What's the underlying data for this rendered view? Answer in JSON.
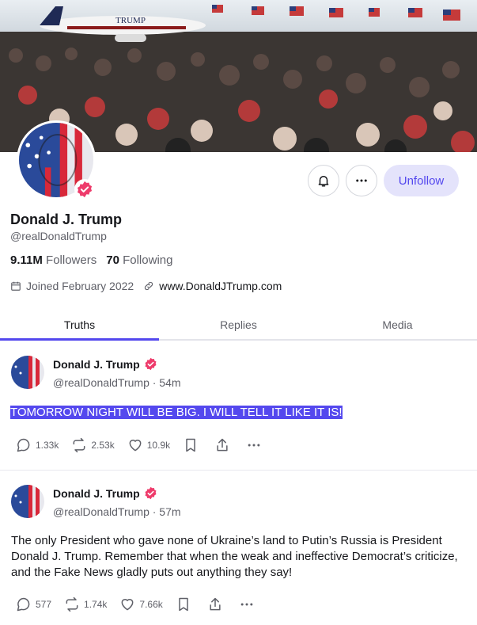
{
  "banner": {
    "plane_text": "TRUMP"
  },
  "profile": {
    "name": "Donald J. Trump",
    "handle": "@realDonaldTrump",
    "followers_count": "9.11M",
    "followers_label": "Followers",
    "following_count": "70",
    "following_label": "Following",
    "joined": "Joined February 2022",
    "website": "www.DonaldJTrump.com"
  },
  "actions": {
    "unfollow_label": "Unfollow"
  },
  "tabs": [
    {
      "label": "Truths",
      "active": true
    },
    {
      "label": "Replies",
      "active": false
    },
    {
      "label": "Media",
      "active": false
    }
  ],
  "posts": [
    {
      "author": "Donald J. Trump",
      "meta": "@realDonaldTrump · 54m",
      "text": "TOMORROW NIGHT WILL BE BIG. I WILL TELL IT LIKE IT IS!",
      "replies": "1.33k",
      "retruths": "2.53k",
      "likes": "10.9k"
    },
    {
      "author": "Donald J. Trump",
      "meta": "@realDonaldTrump · 57m",
      "text": "The only President who gave none of Ukraine’s land to Putin’s Russia is President Donald J. Trump. Remember that when the weak and ineffective Democrat’s criticize, and the Fake News gladly puts out anything they say!",
      "replies": "577",
      "retruths": "1.74k",
      "likes": "7.66k"
    }
  ],
  "colors": {
    "accent": "#5448ee",
    "verified": "#ee3b6b",
    "unfollow_bg": "#e4e3fb"
  },
  "icons": [
    "bell-icon",
    "more-icon",
    "calendar-icon",
    "link-icon",
    "reply-icon",
    "retruth-icon",
    "like-icon",
    "bookmark-icon",
    "share-icon",
    "verified-icon"
  ]
}
